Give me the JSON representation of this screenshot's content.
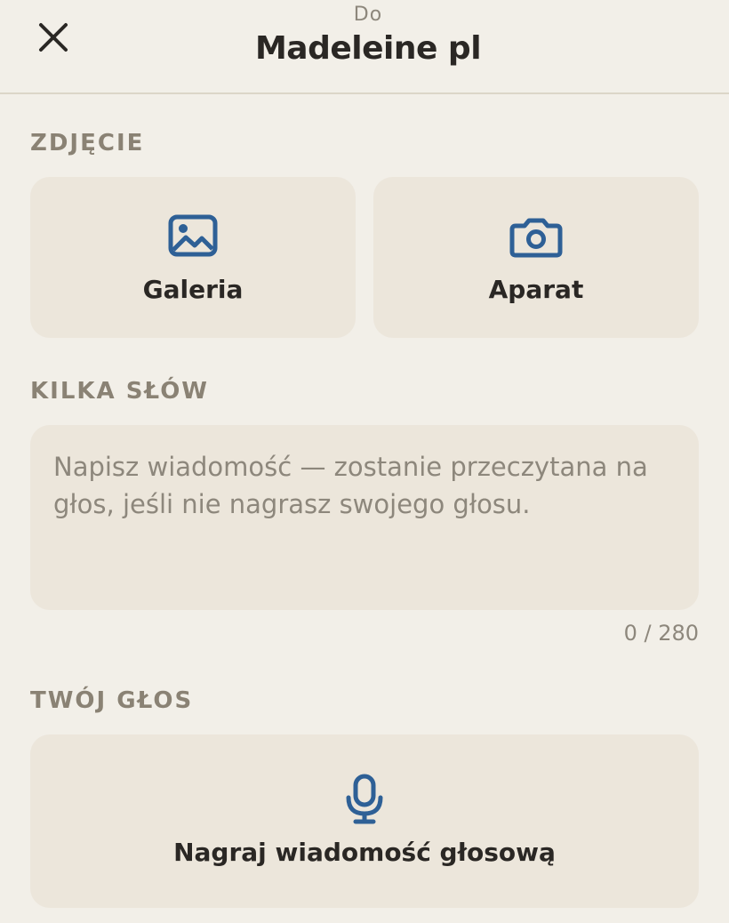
{
  "header": {
    "to_label": "Do",
    "recipient": "Madeleine pl",
    "close_icon": "close-icon"
  },
  "photo": {
    "section_label": "ZDJĘCIE",
    "gallery": {
      "label": "Galeria",
      "icon": "image-icon"
    },
    "camera": {
      "label": "Aparat",
      "icon": "camera-icon"
    }
  },
  "message": {
    "section_label": "KILKA SŁÓW",
    "value": "",
    "placeholder": "Napisz wiadomość — zostanie przeczytana na głos, jeśli nie nagrasz swojego głosu.",
    "counter": "0 / 280"
  },
  "voice": {
    "section_label": "TWÓJ GŁOS",
    "record_label": "Nagraj wiadomość głosową",
    "icon": "microphone-icon"
  },
  "colors": {
    "background": "#f2efe8",
    "card": "#ece6db",
    "accent": "#2e6096",
    "muted_text": "#8a8274"
  }
}
